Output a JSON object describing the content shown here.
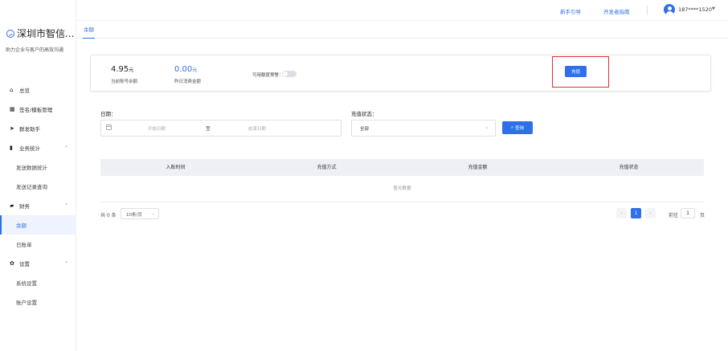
{
  "sidebar": {
    "logo_text": "深圳市智信...",
    "slogan": "助力企业与客户的高效沟通",
    "items": [
      {
        "label": "总览",
        "icon": "home-icon"
      },
      {
        "label": "签名/模板管理",
        "icon": "grid-icon"
      },
      {
        "label": "群发助手",
        "icon": "send-icon"
      },
      {
        "label": "业务统计",
        "icon": "bar-chart-icon"
      },
      {
        "label": "发送数据统计"
      },
      {
        "label": "发送记录查询"
      },
      {
        "label": "财务",
        "icon": "wallet-icon"
      },
      {
        "label": "余额"
      },
      {
        "label": "日账单"
      },
      {
        "label": "设置",
        "icon": "gear-icon"
      },
      {
        "label": "系统设置"
      },
      {
        "label": "账户设置"
      }
    ]
  },
  "header": {
    "guide": "新手引导",
    "dev_guide": "开发者指南",
    "user": "187****1520"
  },
  "tabs": [
    {
      "label": "余额"
    }
  ],
  "balance": {
    "current_value": "4.95",
    "current_unit": "元",
    "current_label": "当前账号余额",
    "yesterday_value": "0.00",
    "yesterday_unit": "元",
    "yesterday_label": "昨日消费金额",
    "warning_label": "可用额度预警：",
    "recharge": "充值"
  },
  "filter": {
    "date_label": "日期：",
    "start_placeholder": "开始日期",
    "separator": "至",
    "end_placeholder": "结束日期",
    "status_label": "充值状态：",
    "status_value": "全部",
    "query": "查询"
  },
  "table": {
    "columns": [
      "入账时间",
      "充值方式",
      "充值金额",
      "充值状态"
    ],
    "empty": "暂无数据"
  },
  "pagination": {
    "total": "共 0 条",
    "page_size": "10条/页",
    "prev": "‹",
    "current": "1",
    "next": "›",
    "goto_prefix": "前往",
    "goto_value": "1",
    "goto_suffix": "页"
  },
  "colors": {
    "accent": "#2f6fe8",
    "highlight": "#e03030"
  }
}
